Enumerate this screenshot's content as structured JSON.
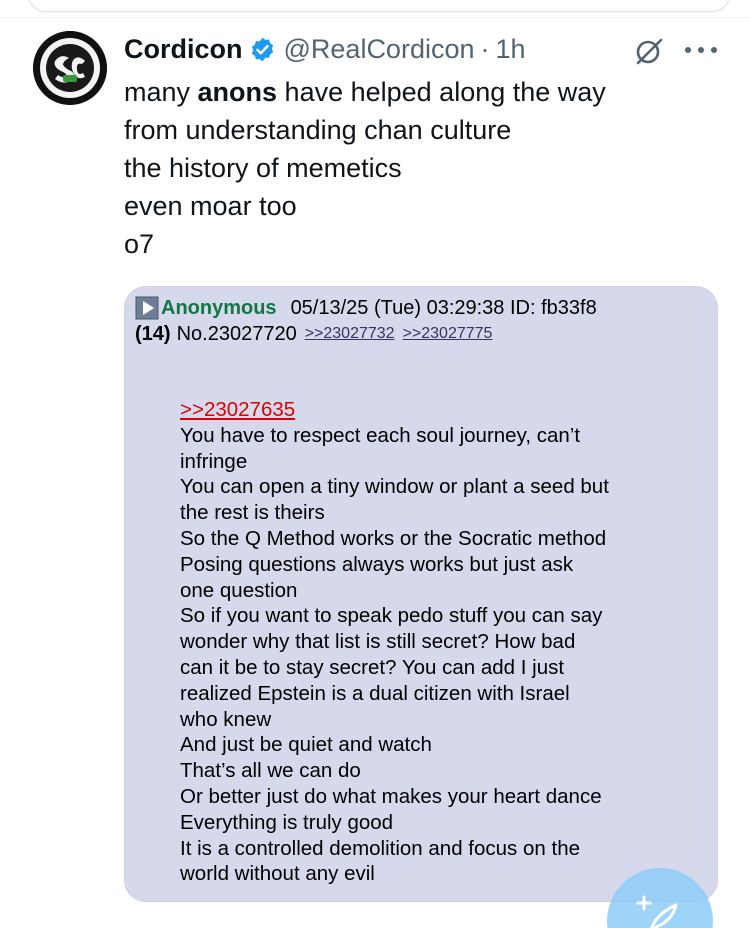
{
  "tweet": {
    "author_name": "Cordicon",
    "author_handle": "@RealCordicon",
    "separator": "·",
    "time": "1h",
    "verified": true,
    "lines": [
      {
        "pre": "many ",
        "bold": "anons",
        "post": " have helped along the way"
      },
      {
        "pre": "from understanding chan culture",
        "bold": "",
        "post": ""
      },
      {
        "pre": "the history of memetics",
        "bold": "",
        "post": ""
      },
      {
        "pre": "even moar too",
        "bold": "",
        "post": ""
      },
      {
        "pre": "o7",
        "bold": "",
        "post": ""
      }
    ]
  },
  "media": {
    "poster_name": "Anonymous",
    "post_meta": "05/13/25 (Tue) 03:29:38 ID: fb33f8",
    "reply_count": "(14)",
    "post_number": "No.23027720",
    "backlinks": [
      ">>23027732",
      ">>23027775"
    ],
    "quote_link": ">>23027635",
    "body_lines": [
      "You have to respect each soul journey, can’t",
      "infringe",
      "You can open a tiny window or plant a seed but",
      "the rest is theirs",
      "So the Q Method works or the Socratic method",
      "Posing questions always works but just ask",
      "one question",
      "So if you want to speak pedo stuff you can say",
      "wonder why that list is still secret? How bad",
      "can it be to stay secret? You can add I just",
      "realized Epstein is a dual citizen with Israel",
      "who knew",
      "And just be quiet and watch",
      "That’s all we can do",
      "Or better just do what makes your heart dance",
      "Everything is truly good",
      "It is a controlled demolition and focus on the",
      "world without any evil"
    ]
  },
  "icons": {
    "avatar": "sc-logo-avatar",
    "verified": "verified-badge-icon",
    "grok": "grok-icon",
    "more": "more-icon",
    "play": "play-icon",
    "compose": "compose-post-icon"
  },
  "colors": {
    "verified_blue": "#1d9bf0",
    "muted_text": "#536471",
    "chan_bg": "#d6d9ec",
    "anon_green": "#117743",
    "quote_red": "#dd0000",
    "fab_blue": "#8ecdf8"
  }
}
